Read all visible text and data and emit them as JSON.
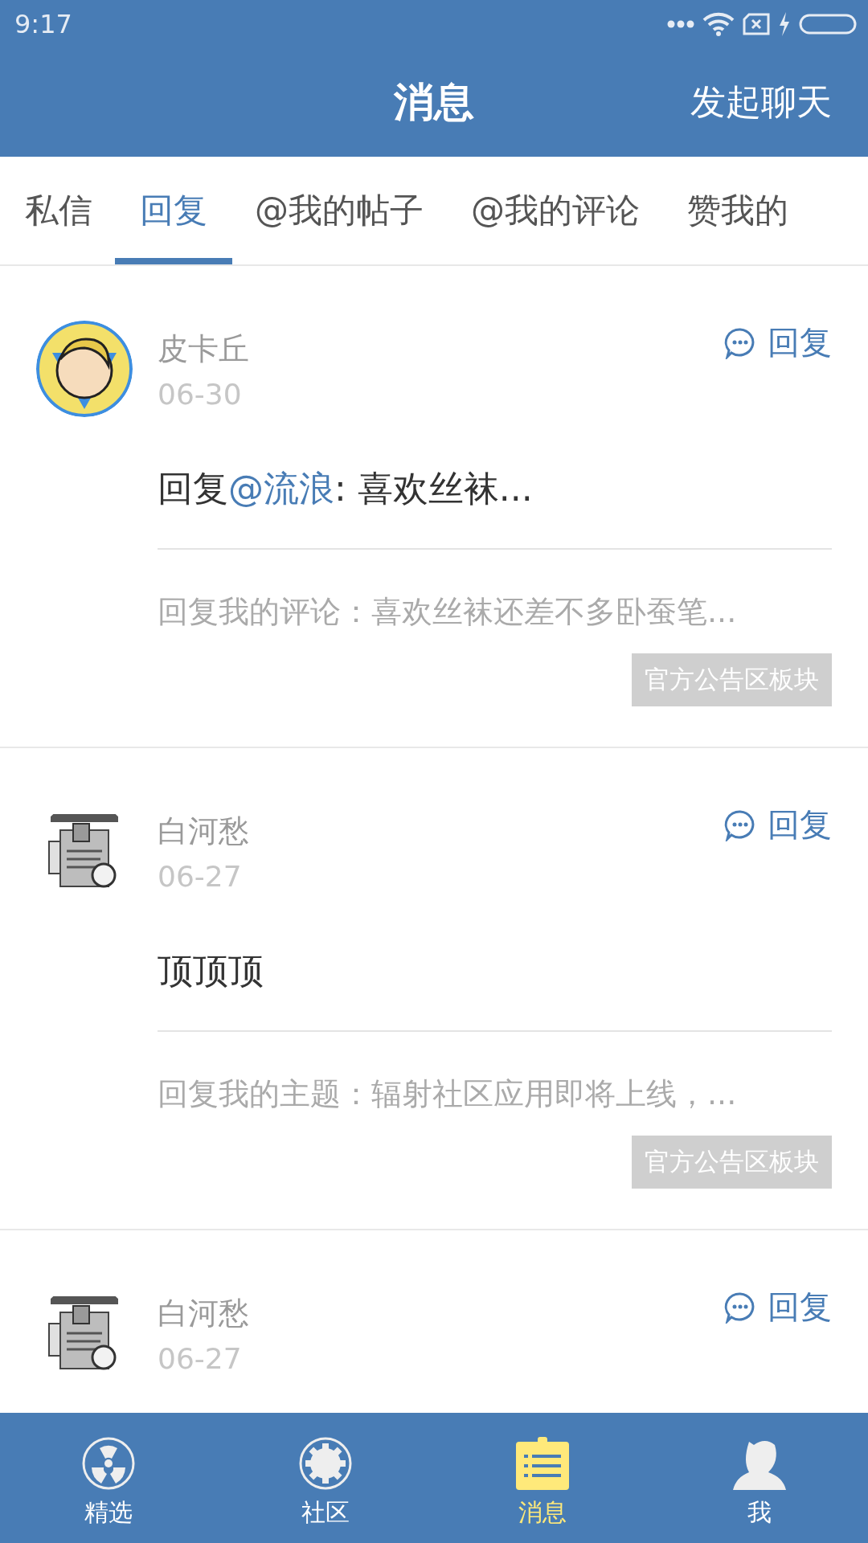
{
  "status_bar": {
    "time": "9:17"
  },
  "header": {
    "title": "消息",
    "action": "发起聊天"
  },
  "tabs": [
    {
      "label": "私信",
      "selected": false
    },
    {
      "label": "回复",
      "selected": true
    },
    {
      "label": "@我的帖子",
      "selected": false
    },
    {
      "label": "@我的评论",
      "selected": false
    },
    {
      "label": "赞我的",
      "selected": false
    }
  ],
  "messages": [
    {
      "avatar": {
        "kind": "picture"
      },
      "name": "皮卡丘",
      "date": "06-30",
      "reply": "回复",
      "content": [
        {
          "kind": "plain",
          "text": "回复"
        },
        {
          "kind": "mention",
          "text": "@流浪"
        },
        {
          "kind": "plain",
          "text": ": 喜欢丝袜..."
        }
      ],
      "summary": "回复我的评论：喜欢丝袜还差不多卧蚕笔...",
      "tag": "官方公告区板块"
    },
    {
      "avatar": {
        "kind": "picture"
      },
      "name": "白河愁",
      "date": "06-27",
      "reply": "回复",
      "content": [
        {
          "kind": "plain",
          "text": "顶顶顶"
        }
      ],
      "summary": "回复我的主题：辐射社区应用即将上线，...",
      "tag": "官方公告区板块"
    },
    {
      "avatar": {
        "kind": "picture"
      },
      "name": "白河愁",
      "date": "06-27",
      "reply": "回复"
    }
  ],
  "bottom_nav": [
    {
      "kind": "radiation",
      "label": "精选",
      "selected": false
    },
    {
      "kind": "gear",
      "label": "社区",
      "selected": false
    },
    {
      "kind": "list",
      "label": "消息",
      "selected": true
    },
    {
      "kind": "person",
      "label": "我",
      "selected": false
    }
  ]
}
